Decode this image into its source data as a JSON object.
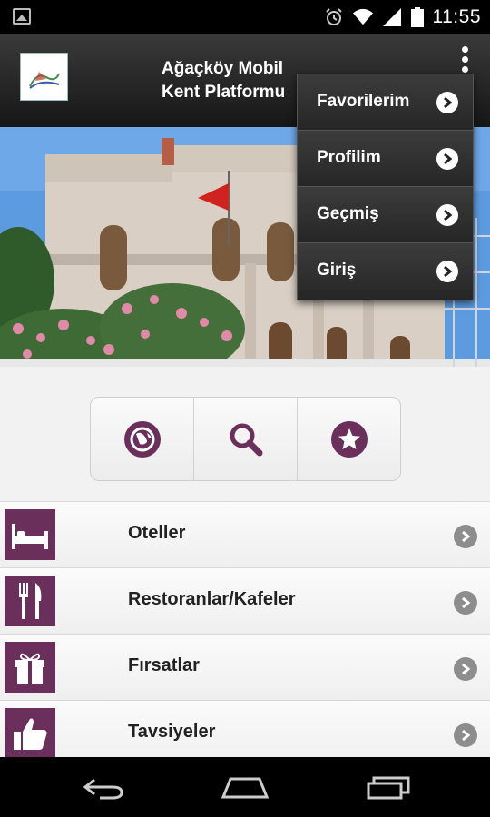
{
  "status_bar": {
    "time": "11:55",
    "icons": [
      "gallery-icon",
      "alarm-icon",
      "wifi-icon",
      "signal-icon",
      "battery-icon"
    ]
  },
  "action_bar": {
    "title_line1": "Ağaçköy Mobil",
    "title_line2": "Kent Platformu",
    "logo_text": "AĞAÇKÖY BELEDİYESİ"
  },
  "overflow_menu": {
    "items": [
      {
        "label": "Favorilerim"
      },
      {
        "label": "Profilim"
      },
      {
        "label": "Geçmiş"
      },
      {
        "label": "Giriş"
      }
    ]
  },
  "segmented": {
    "buttons": [
      "globe-icon",
      "search-icon",
      "star-icon"
    ]
  },
  "list": {
    "items": [
      {
        "label": "Oteller",
        "icon": "bed-icon"
      },
      {
        "label": "Restoranlar/Kafeler",
        "icon": "fork-knife-icon"
      },
      {
        "label": "Fırsatlar",
        "icon": "gift-icon"
      },
      {
        "label": "Tavsiyeler",
        "icon": "thumbs-up-icon"
      }
    ]
  },
  "colors": {
    "accent": "#6b2f5c",
    "action_bar": "#2a2a2a"
  }
}
